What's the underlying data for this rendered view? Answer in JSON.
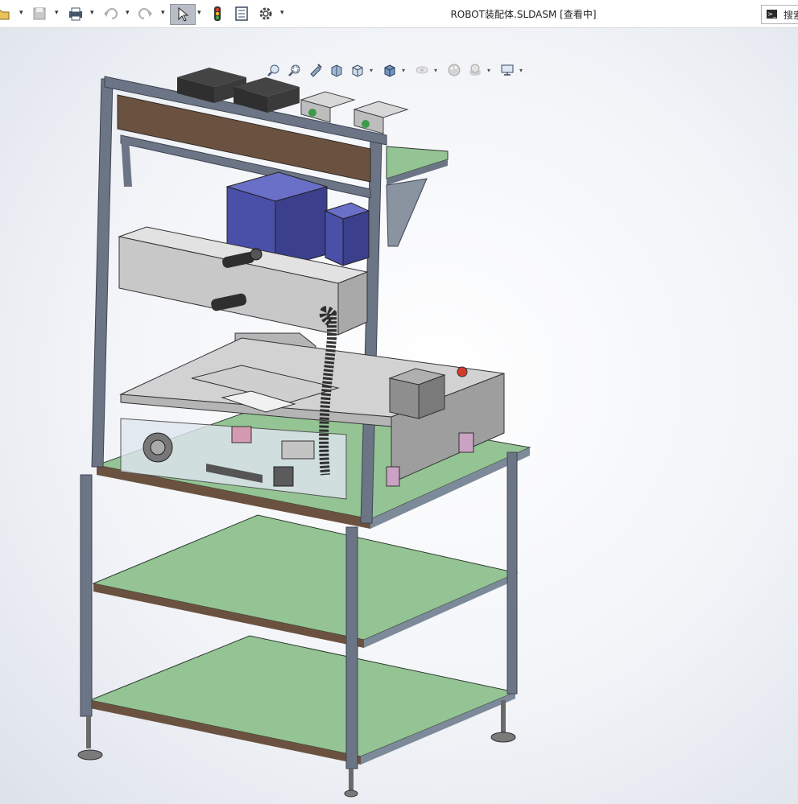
{
  "window": {
    "title": "ROBOT装配体.SLDASM [查看中]",
    "search_placeholder": "搜索"
  },
  "toolbar": {
    "icons": [
      "open-icon",
      "save-icon",
      "print-icon",
      "undo-icon",
      "redo-icon",
      "select-icon",
      "rebuild-icon",
      "file-properties-icon",
      "options-icon"
    ],
    "dropdown_glyph": "▾"
  },
  "heads_up_toolbar": {
    "icons": [
      "zoom-to-fit-icon",
      "zoom-to-area-icon",
      "previous-view-icon",
      "section-view-icon",
      "view-orientation-icon",
      "display-style-icon",
      "hide-show-icon",
      "edit-appearance-icon",
      "apply-scene-icon",
      "view-settings-icon"
    ]
  },
  "model": {
    "description_free": true,
    "colors": {
      "frame": "#6b7585",
      "frame_dark": "#3d4452",
      "board_wood": "#6b5240",
      "shelf_green": "#94c494",
      "housing_grey": "#c8c8c8",
      "motor_blue": "#4a4fa8",
      "dark_component": "#2f2f2f"
    }
  }
}
